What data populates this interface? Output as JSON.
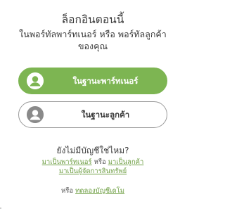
{
  "login": {
    "title": "ล็อกอินตอนนี้",
    "subtitle": "ในพอร์ทัลพาร์ทเนอร์ หรือ พอร์ทัลลูกค้าของคุณ"
  },
  "roles": {
    "partner": {
      "label": "ในฐานะพาร์ทเนอร์",
      "icon": "user-avatar-icon"
    },
    "customer": {
      "label": "ในฐานะลูกค้า",
      "icon": "user-avatar-icon"
    }
  },
  "signup": {
    "question": "ยังไม่มีบัญชีใช่ไหม?",
    "become_partner": "มาเป็นพาร์ทเนอร์",
    "or_1": "หรือ",
    "become_customer": "มาเป็นลูกค้า",
    "become_supplier": "มาเป็นผู้จัดการสินทรัพย์",
    "or_2": "หรือ",
    "trial_account": "ทดลองบัญชีเดโม"
  },
  "colors": {
    "accent_green": "#7db552",
    "link_green": "#6f9f44",
    "border_grey": "#9a9a9a",
    "text_dark": "#3a3a3a"
  }
}
